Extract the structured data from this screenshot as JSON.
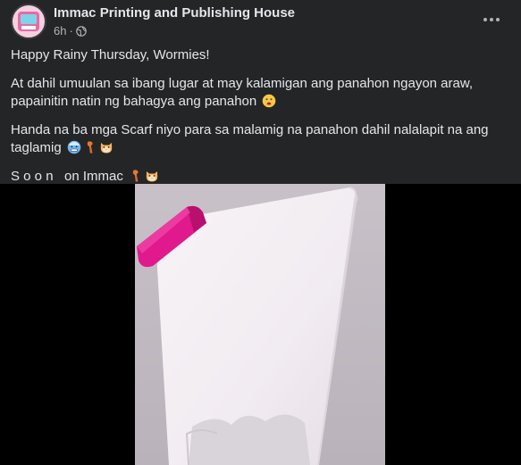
{
  "post": {
    "page_name": "Immac Printing and Publishing House",
    "time": "6h",
    "separator": "·",
    "audience_icon": "globe-icon",
    "more_icon": "more-horizontal-icon",
    "lines": {
      "greeting": "Happy Rainy Thursday, Wormies!",
      "paragraph_1": "At dahil umuulan sa ibang lugar at may kalamigan ang panahon ngayon araw, papainitin natin ng bahagya ang panahon",
      "paragraph_2": "Handa na ba mga Scarf niyo para sa malamig na panahon dahil nalalapit na ang taglamig",
      "soon": "S o o n   on Immac"
    },
    "emojis": [
      "face-with-hand-over-mouth-emoji",
      "cold-face-emoji",
      "scarf-emoji",
      "cat-face-emoji"
    ]
  },
  "media": {
    "type": "video",
    "colors": {
      "background": "#000000",
      "paper": "#f4f0f3",
      "pink_marker": "#e0198c"
    }
  },
  "colors": {
    "card_bg": "#242526",
    "primary_text": "#e4e6eb",
    "secondary_text": "#b0b3b8"
  }
}
